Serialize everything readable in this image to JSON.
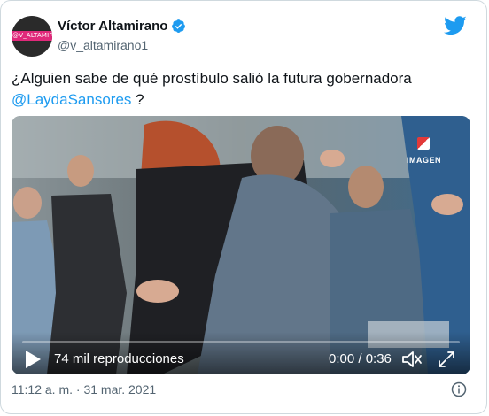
{
  "author": {
    "display_name": "Víctor Altamirano",
    "handle": "@v_altamirano1",
    "avatar_text": "@V_ALTAMIRA",
    "verified": true
  },
  "tweet": {
    "text_before": "¿Alguien sabe de qué prostíbulo salió la futura gobernadora",
    "mention": "@LaydaSansores",
    "text_after": " ?"
  },
  "video": {
    "views_label": "74 mil reproducciones",
    "time_label": "0:00 / 0:36",
    "progress": 0,
    "watermark": "IMAGEN"
  },
  "timestamp": "11:12 a. m. · 31 mar. 2021",
  "icons": {
    "brand": "twitter-bird-icon",
    "verified": "verified-badge-icon",
    "play": "play-icon",
    "volume": "volume-icon",
    "fullscreen": "fullscreen-icon",
    "info": "info-icon"
  },
  "colors": {
    "accent": "#1d9bf0",
    "text": "#0f1419",
    "muted": "#536471"
  }
}
